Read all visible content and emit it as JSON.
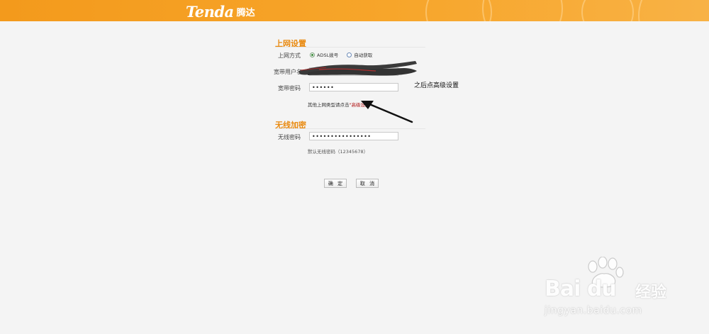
{
  "header": {
    "brand": "Tenda",
    "brand_cn": "腾达",
    "accent_color": "#f39a1c"
  },
  "internet_settings": {
    "title": "上网设置",
    "connection_type_label": "上网方式",
    "options": [
      {
        "label": "ADSL拨号",
        "selected": true
      },
      {
        "label": "自动获取",
        "selected": false
      }
    ],
    "username_label": "宽带用户名",
    "password_label": "宽带密码",
    "password_value": "••••••",
    "hint_prefix": "其他上网类型请点击",
    "hint_link": "\"高级设置\""
  },
  "wireless": {
    "title": "无线加密",
    "password_label": "无线密码",
    "password_value": "••••••••••••••••",
    "default_note": "默认无线密码（12345678）"
  },
  "buttons": {
    "ok_label": "确 定",
    "cancel_label": "取 消"
  },
  "annotation": {
    "text": "之后点高级设置"
  },
  "watermark": {
    "logo": "Bai du",
    "product": "经验",
    "url": "jingyan.baidu.com"
  }
}
